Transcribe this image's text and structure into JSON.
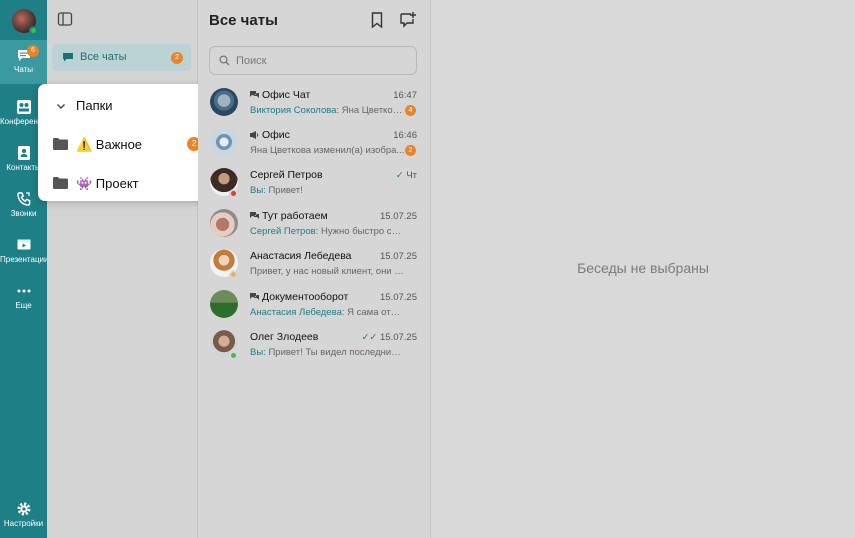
{
  "rail": {
    "chats": {
      "label": "Чаты",
      "badge": "6"
    },
    "conferences": {
      "label": "Конференции"
    },
    "contacts": {
      "label": "Контакты"
    },
    "calls": {
      "label": "Звонки"
    },
    "presentations": {
      "label": "Презентации"
    },
    "more": {
      "label": "Еще"
    },
    "settings": {
      "label": "Настройки"
    }
  },
  "folders": {
    "all_chats": {
      "label": "Все чаты",
      "badge": "2"
    }
  },
  "popup": {
    "header": "Папки",
    "items": [
      {
        "label": "⚠️ Важное",
        "badge": "2"
      },
      {
        "label": "👾 Проект",
        "badge": ""
      }
    ]
  },
  "list": {
    "title": "Все чаты",
    "search_placeholder": "Поиск",
    "chats": [
      {
        "name": "Офис Чат",
        "time": "16:47",
        "sender": "Виктория Соколова:",
        "preview": " Яна Цветков...",
        "badge": "4",
        "avatar": "group-photo",
        "group_icon": "group-chat-icon"
      },
      {
        "name": "Офис",
        "time": "16:46",
        "sender": "",
        "preview": "Яна Цветкова изменил(а) изобра...",
        "badge": "2",
        "avatar": "globe-logo",
        "group_icon": "channel-icon"
      },
      {
        "name": "Сергей Петров",
        "time": "Чт",
        "sender": "Вы:",
        "preview": " Привет!",
        "badge": "",
        "avatar": "person-dark",
        "read": true,
        "status": "busy"
      },
      {
        "name": "Тут работаем",
        "time": "15.07.25",
        "sender": "Сергей Петров:",
        "preview": " Нужно быстро созво...",
        "badge": "",
        "avatar": "hands-photo",
        "group_icon": "group-chat-icon"
      },
      {
        "name": "Анастасия Лебедева",
        "time": "15.07.25",
        "sender": "",
        "preview": "Привет, у нас новый клиент, они не п...",
        "badge": "",
        "avatar": "woman-photo",
        "status": "star"
      },
      {
        "name": "Документооборот",
        "time": "15.07.25",
        "sender": "Анастасия Лебедева:",
        "preview": " Я сама отправ...",
        "badge": "",
        "avatar": "field-photo",
        "group_icon": "group-chat-icon"
      },
      {
        "name": "Олег Злодеев",
        "time": "15.07.25",
        "sender": "Вы:",
        "preview": " Привет! Ты видел последние пра...",
        "badge": "",
        "avatar": "man-photo",
        "read": true,
        "double_check": true,
        "status": "online"
      }
    ]
  },
  "main": {
    "empty_text": "Беседы не выбраны"
  },
  "colors": {
    "rail": "#1e7f86",
    "accent": "#1d7d84",
    "badge": "#e8842c",
    "online": "#3ac24a",
    "busy": "#e23b3b"
  }
}
